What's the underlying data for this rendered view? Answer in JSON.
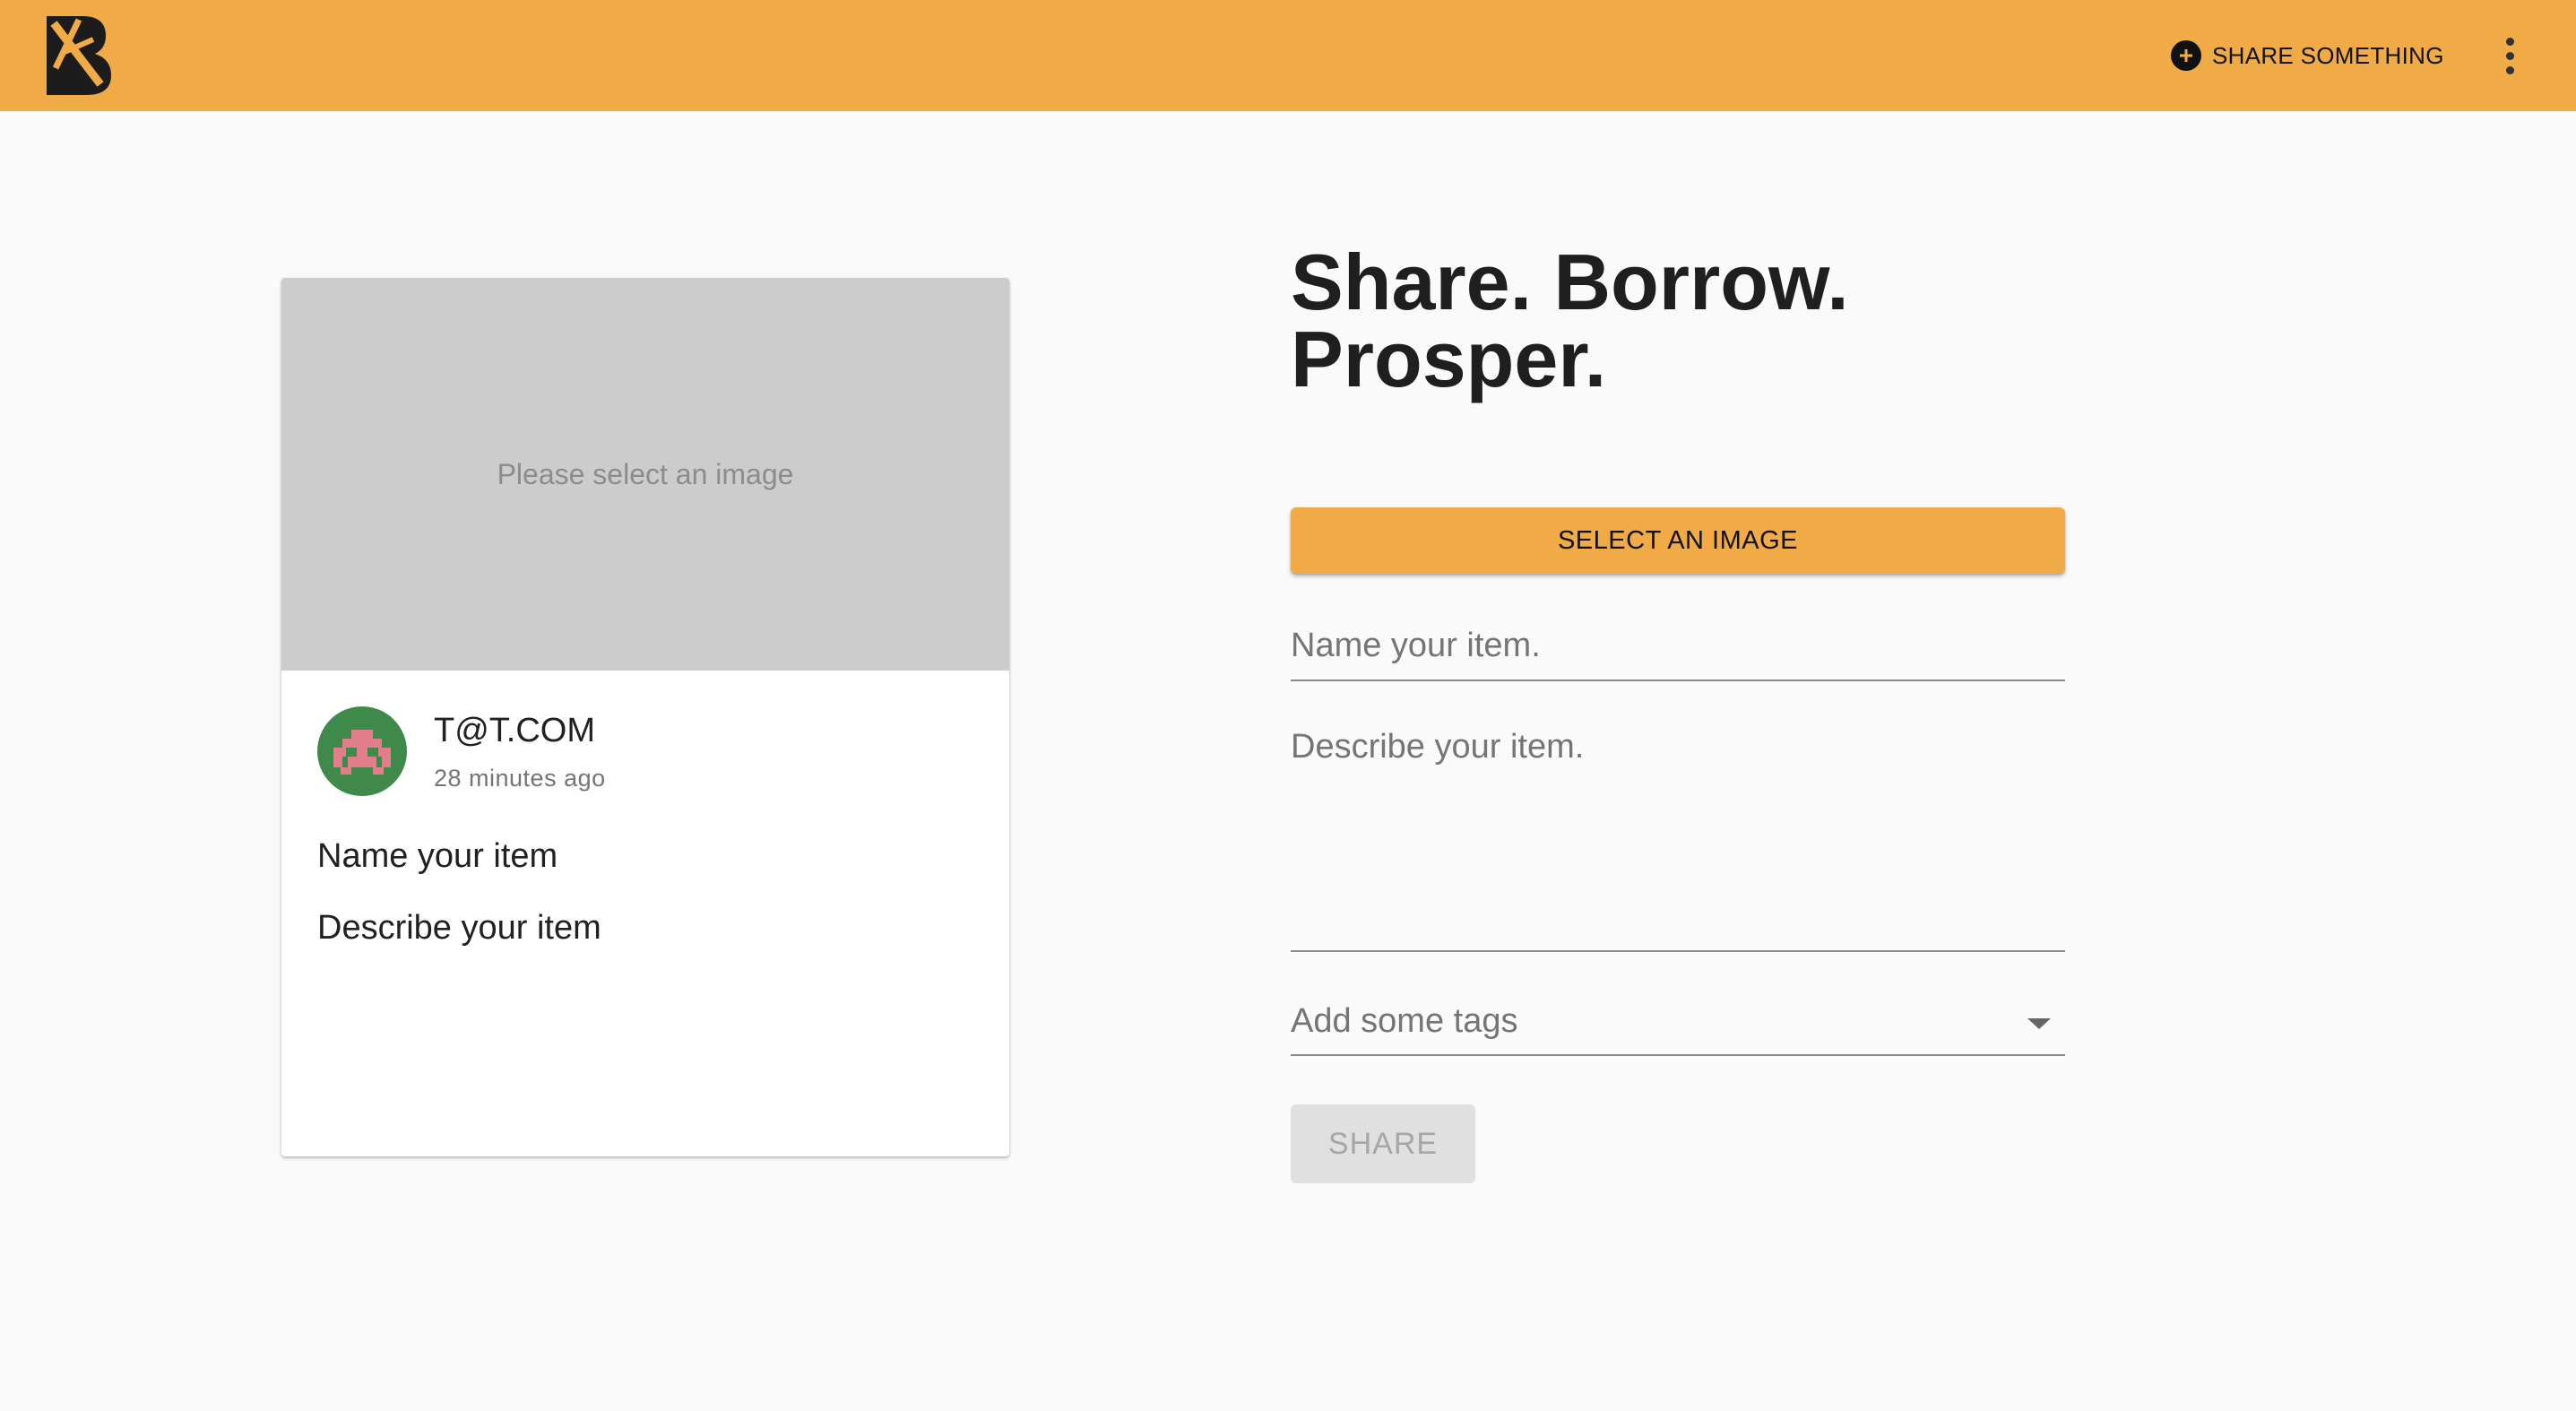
{
  "header": {
    "logo_icon": "boomtown-logo-icon",
    "share_label": "SHARE SOMETHING",
    "share_icon": "plus-circle-icon",
    "menu_icon": "more-vert-icon",
    "accent_color": "#f0ab47"
  },
  "preview_card": {
    "image_hint": "Please select an image",
    "user_email": "T@T.COM",
    "timestamp": "28 minutes ago",
    "title": "Name your item",
    "description": "Describe your item",
    "avatar_icon": "identicon-avatar"
  },
  "form": {
    "headline_line1": "Share. Borrow.",
    "headline_line2": "Prosper.",
    "select_image_label": "SELECT AN IMAGE",
    "name_placeholder": "Name your item.",
    "description_placeholder": "Describe your item.",
    "tags_placeholder": "Add some tags",
    "share_label": "SHARE"
  }
}
